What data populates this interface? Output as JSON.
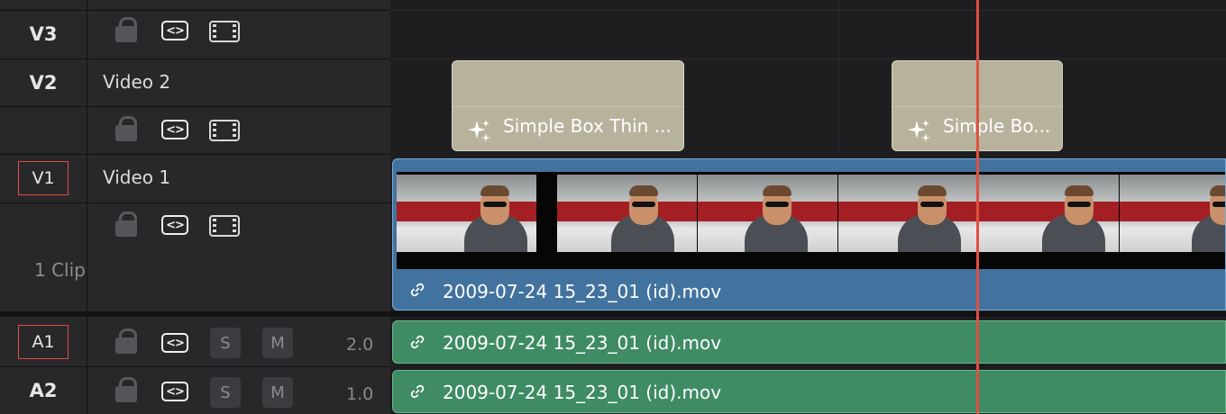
{
  "tracks": {
    "v3": {
      "id": "V3"
    },
    "v2": {
      "id": "V2",
      "name": "Video 2"
    },
    "v1": {
      "id": "V1",
      "name": "Video 1",
      "clip_count": "1 Clip"
    },
    "a1": {
      "id": "A1",
      "solo": "S",
      "mute": "M",
      "level": "2.0"
    },
    "a2": {
      "id": "A2",
      "solo": "S",
      "mute": "M",
      "level": "1.0"
    }
  },
  "icons": {
    "lock": "lock-icon",
    "auto_select": "auto-select-icon",
    "auto_select_glyph": "<>",
    "filmstrip": "filmstrip-icon",
    "link": "link-icon",
    "sparkle": "sparkle-icon"
  },
  "clips": {
    "title1": "Simple Box Thin ...",
    "title2": "Simple Bo...",
    "video": "2009-07-24 15_23_01 (id).mov",
    "audio1": "2009-07-24 15_23_01 (id).mov",
    "audio2": "2009-07-24 15_23_01 (id).mov"
  },
  "colors": {
    "playhead": "#e0503f",
    "video_clip": "#42739f",
    "audio_clip": "#3f8b64",
    "title_clip": "#b7b29b",
    "header_bg": "#28282b"
  }
}
